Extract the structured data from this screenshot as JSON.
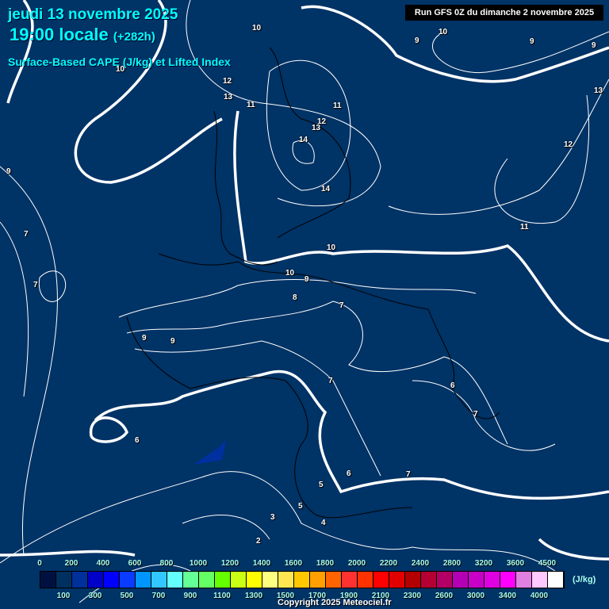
{
  "header": {
    "date": "jeudi 13 novembre 2025",
    "time": "19:00 locale",
    "lead": "(+282h)",
    "product": "Surface-Based CAPE (J/kg) et Lifted Index",
    "run": "Run GFS 0Z du dimanche 2 novembre 2025"
  },
  "contour_labels": [
    "10",
    "10",
    "9",
    "9",
    "9",
    "12",
    "13",
    "11",
    "11",
    "12",
    "13",
    "14",
    "14",
    "12",
    "11",
    "9",
    "7",
    "7",
    "10",
    "10",
    "9",
    "8",
    "7",
    "9",
    "9",
    "7",
    "6",
    "7",
    "6",
    "6",
    "7",
    "5",
    "5",
    "4",
    "3",
    "2",
    "10",
    "13"
  ],
  "legend": {
    "unit": "(J/kg)",
    "top_labels": [
      "0",
      "200",
      "400",
      "600",
      "800",
      "1000",
      "1200",
      "1400",
      "1600",
      "1800",
      "2000",
      "2200",
      "2400",
      "2800",
      "3200",
      "3600",
      "4500"
    ],
    "bottom_labels": [
      "100",
      "300",
      "500",
      "700",
      "900",
      "1100",
      "1300",
      "1500",
      "1700",
      "1900",
      "2100",
      "2300",
      "2600",
      "3000",
      "3400",
      "4000"
    ],
    "colors": [
      "#001040",
      "#003060",
      "#00309a",
      "#0000c8",
      "#0000ff",
      "#0a3cff",
      "#0096ff",
      "#32c8ff",
      "#64ffff",
      "#64ff96",
      "#64ff64",
      "#64ff00",
      "#c8ff14",
      "#ffff00",
      "#ffff80",
      "#ffe650",
      "#ffc800",
      "#ffa000",
      "#ff6400",
      "#ff3232",
      "#ff3200",
      "#ff0000",
      "#e10000",
      "#b40000",
      "#b40032",
      "#b40064",
      "#b400b4",
      "#c800c8",
      "#e100e1",
      "#ff00ff",
      "#e180e1",
      "#ffc8ff",
      "#ffffff"
    ]
  },
  "copyright": "Copyright 2025 Meteociel.fr"
}
